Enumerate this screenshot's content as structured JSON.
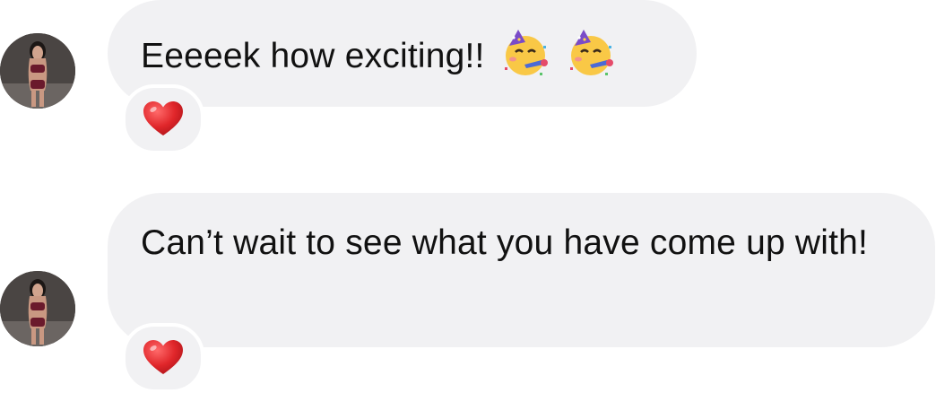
{
  "messages": [
    {
      "text": "Eeeeek how exciting!!",
      "emojis": [
        "partying-face-emoji",
        "partying-face-emoji"
      ],
      "reaction": "heart-emoji"
    },
    {
      "text": "Can’t wait to see what you have come up with!",
      "emojis": [],
      "reaction": "heart-emoji"
    }
  ],
  "colors": {
    "bubble_background": "#f1f1f3",
    "text": "#111111",
    "heart": "#e0262a"
  }
}
